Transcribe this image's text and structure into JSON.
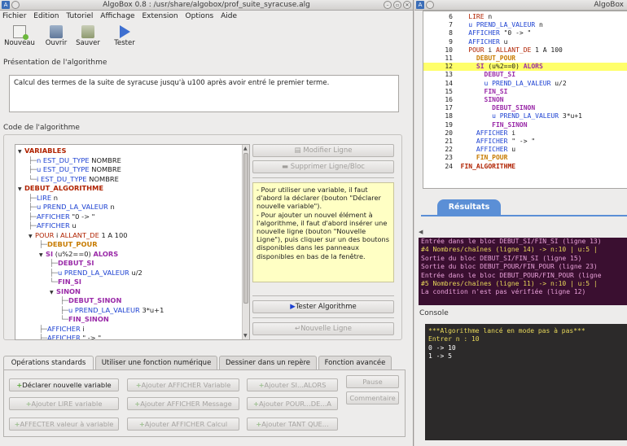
{
  "left_window": {
    "title": "AlgoBox 0.8 : /usr/share/algobox/prof_suite_syracuse.alg",
    "menu": [
      "Fichier",
      "Edition",
      "Tutoriel",
      "Affichage",
      "Extension",
      "Options",
      "Aide"
    ],
    "toolbar": {
      "new_label": "Nouveau",
      "open_label": "Ouvrir",
      "save_label": "Sauver",
      "test_label": "Tester"
    },
    "presentation_label": "Présentation de l'algorithme",
    "presentation_text": "Calcul des termes de la suite de syracuse jusqu'à u100 après avoir entré le premier terme.",
    "code_label": "Code de l'algorithme",
    "tree": [
      {
        "prefix": "▼",
        "parts": [
          [
            "kw",
            "VARIABLES"
          ]
        ]
      },
      {
        "prefix": "├─",
        "parts": [
          [
            "blue",
            "n"
          ],
          [
            "plain",
            " "
          ],
          [
            "blue",
            "EST_DU_TYPE"
          ],
          [
            "plain",
            " NOMBRE"
          ]
        ]
      },
      {
        "prefix": "├─",
        "parts": [
          [
            "blue",
            "u"
          ],
          [
            "plain",
            " "
          ],
          [
            "blue",
            "EST_DU_TYPE"
          ],
          [
            "plain",
            " NOMBRE"
          ]
        ]
      },
      {
        "prefix": "└─",
        "parts": [
          [
            "blue",
            "i"
          ],
          [
            "plain",
            " "
          ],
          [
            "blue",
            "EST_DU_TYPE"
          ],
          [
            "plain",
            " NOMBRE"
          ]
        ]
      },
      {
        "prefix": "▼",
        "parts": [
          [
            "kw",
            "DEBUT_ALGORITHME"
          ]
        ]
      },
      {
        "prefix": "├─",
        "parts": [
          [
            "blue",
            "LIRE"
          ],
          [
            "plain",
            " n"
          ]
        ]
      },
      {
        "prefix": "├─",
        "parts": [
          [
            "blue",
            "u"
          ],
          [
            "plain",
            " "
          ],
          [
            "blue",
            "PREND_LA_VALEUR"
          ],
          [
            "plain",
            " n"
          ]
        ]
      },
      {
        "prefix": "├─",
        "parts": [
          [
            "blue",
            "AFFICHER"
          ],
          [
            "plain",
            " \"0 -> \""
          ]
        ]
      },
      {
        "prefix": "├─",
        "parts": [
          [
            "blue",
            "AFFICHER"
          ],
          [
            "plain",
            " u"
          ]
        ]
      },
      {
        "prefix": "▼",
        "parts": [
          [
            "kw2",
            "POUR"
          ],
          [
            "plain",
            " i "
          ],
          [
            "kw2",
            "ALLANT_DE"
          ],
          [
            "plain",
            " 1 A 100"
          ]
        ]
      },
      {
        "prefix": "├─",
        "parts": [
          [
            "kwy",
            "DEBUT_POUR"
          ]
        ]
      },
      {
        "prefix": "▼",
        "parts": [
          [
            "kwm",
            "SI"
          ],
          [
            "plain",
            " (u%2==0) "
          ],
          [
            "kwm",
            "ALORS"
          ]
        ]
      },
      {
        "prefix": "├─",
        "parts": [
          [
            "kwm",
            "DEBUT_SI"
          ]
        ]
      },
      {
        "prefix": "├─",
        "parts": [
          [
            "blue",
            "u"
          ],
          [
            "plain",
            " "
          ],
          [
            "blue",
            "PREND_LA_VALEUR"
          ],
          [
            "plain",
            " u/2"
          ]
        ]
      },
      {
        "prefix": "└─",
        "parts": [
          [
            "kwm",
            "FIN_SI"
          ]
        ]
      },
      {
        "prefix": "▼",
        "parts": [
          [
            "kwm",
            "SINON"
          ]
        ]
      },
      {
        "prefix": "├─",
        "parts": [
          [
            "kwm",
            "DEBUT_SINON"
          ]
        ]
      },
      {
        "prefix": "├─",
        "parts": [
          [
            "blue",
            "u"
          ],
          [
            "plain",
            " "
          ],
          [
            "blue",
            "PREND_LA_VALEUR"
          ],
          [
            "plain",
            " 3*u+1"
          ]
        ]
      },
      {
        "prefix": "└─",
        "parts": [
          [
            "kwm",
            "FIN_SINON"
          ]
        ]
      },
      {
        "prefix": "├─",
        "parts": [
          [
            "blue",
            "AFFICHER"
          ],
          [
            "plain",
            " i"
          ]
        ]
      },
      {
        "prefix": "├─",
        "parts": [
          [
            "blue",
            "AFFICHER"
          ],
          [
            "plain",
            " \" -> \""
          ]
        ]
      }
    ],
    "buttons": {
      "modify_line": "Modifier Ligne",
      "delete_line": "Supprimer Ligne/Bloc",
      "test_algorithm": "Tester Algorithme",
      "new_line": "Nouvelle Ligne"
    },
    "help_text": "- Pour utiliser une variable, il faut d'abord la déclarer (bouton \"Déclarer nouvelle variable\").\n- Pour ajouter un nouvel élément à l'algorithme, il faut d'abord insérer une nouvelle ligne (bouton \"Nouvelle Ligne\"), puis cliquer sur un des boutons disponibles dans les panneaux disponibles en bas de la fenêtre.",
    "tabs": [
      "Opérations standards",
      "Utiliser une fonction numérique",
      "Dessiner dans un repère",
      "Fonction avancée"
    ],
    "ops": {
      "declare_variable": "Déclarer nouvelle variable",
      "add_read": "Ajouter LIRE variable",
      "assign": "AFFECTER valeur à variable",
      "add_print_var": "Ajouter AFFICHER Variable",
      "add_print_msg": "Ajouter AFFICHER Message",
      "add_print_calc": "Ajouter AFFICHER Calcul",
      "add_if": "Ajouter SI...ALORS",
      "add_for": "Ajouter POUR...DE...A",
      "add_while": "Ajouter TANT QUE...",
      "pause": "Pause",
      "comment": "Commentaire"
    }
  },
  "right_window": {
    "title": "AlgoBox",
    "code_lines": [
      {
        "n": "6",
        "indent": "  ",
        "parts": [
          [
            "kw2",
            "LIRE"
          ],
          [
            "plain",
            " n"
          ]
        ]
      },
      {
        "n": "7",
        "indent": "  ",
        "parts": [
          [
            "blue",
            "u PREND_LA_VALEUR"
          ],
          [
            "plain",
            " n"
          ]
        ]
      },
      {
        "n": "8",
        "indent": "  ",
        "parts": [
          [
            "blue",
            "AFFICHER"
          ],
          [
            "plain",
            " \"0 -> \""
          ]
        ]
      },
      {
        "n": "9",
        "indent": "  ",
        "parts": [
          [
            "blue",
            "AFFICHER"
          ],
          [
            "plain",
            " u"
          ]
        ]
      },
      {
        "n": "10",
        "indent": "  ",
        "parts": [
          [
            "kw2",
            "POUR"
          ],
          [
            "plain",
            " i "
          ],
          [
            "kw2",
            "ALLANT_DE"
          ],
          [
            "plain",
            " 1 A 100"
          ]
        ]
      },
      {
        "n": "11",
        "indent": "    ",
        "parts": [
          [
            "kwy",
            "DEBUT_POUR"
          ]
        ]
      },
      {
        "n": "12",
        "indent": "    ",
        "parts": [
          [
            "kwm",
            "SI"
          ],
          [
            "plain",
            " (u%2==0) "
          ],
          [
            "kwm",
            "ALORS"
          ]
        ],
        "highlight": true
      },
      {
        "n": "13",
        "indent": "      ",
        "parts": [
          [
            "kwm",
            "DEBUT_SI"
          ]
        ]
      },
      {
        "n": "14",
        "indent": "      ",
        "parts": [
          [
            "blue",
            "u PREND_LA_VALEUR"
          ],
          [
            "plain",
            " u/2"
          ]
        ]
      },
      {
        "n": "15",
        "indent": "      ",
        "parts": [
          [
            "kwm",
            "FIN_SI"
          ]
        ]
      },
      {
        "n": "16",
        "indent": "      ",
        "parts": [
          [
            "kwm",
            "SINON"
          ]
        ]
      },
      {
        "n": "17",
        "indent": "        ",
        "parts": [
          [
            "kwm",
            "DEBUT_SINON"
          ]
        ]
      },
      {
        "n": "18",
        "indent": "        ",
        "parts": [
          [
            "blue",
            "u PREND_LA_VALEUR"
          ],
          [
            "plain",
            " 3*u+1"
          ]
        ]
      },
      {
        "n": "19",
        "indent": "        ",
        "parts": [
          [
            "kwm",
            "FIN_SINON"
          ]
        ]
      },
      {
        "n": "20",
        "indent": "    ",
        "parts": [
          [
            "blue",
            "AFFICHER"
          ],
          [
            "plain",
            " i"
          ]
        ]
      },
      {
        "n": "21",
        "indent": "    ",
        "parts": [
          [
            "blue",
            "AFFICHER"
          ],
          [
            "plain",
            " \" -> \""
          ]
        ]
      },
      {
        "n": "22",
        "indent": "    ",
        "parts": [
          [
            "blue",
            "AFFICHER"
          ],
          [
            "plain",
            " u"
          ]
        ]
      },
      {
        "n": "23",
        "indent": "    ",
        "parts": [
          [
            "kwy",
            "FIN_POUR"
          ]
        ]
      },
      {
        "n": "24",
        "indent": "",
        "parts": [
          [
            "kw",
            "FIN_ALGORITHME"
          ]
        ]
      }
    ],
    "results_label": "Résultats",
    "trace_lines": [
      {
        "text": "Entrée dans le bloc DEBUT_SI/FIN_SI (ligne 13)",
        "color": "#e8a0d8"
      },
      {
        "text": "#4 Nombres/chaînes (ligne 14) -> n:10 | u:5 |",
        "color": "#e8d85a"
      },
      {
        "text": "Sortie du bloc DEBUT_SI/FIN_SI (ligne 15)",
        "color": "#e8a0d8"
      },
      {
        "text": "Sortie du bloc DEBUT_POUR/FIN_POUR (ligne 23)",
        "color": "#e8a0d8"
      },
      {
        "text": "Entrée dans le bloc DEBUT_POUR/FIN_POUR (ligne",
        "color": "#e8a0d8"
      },
      {
        "text": "#5 Nombres/chaînes (ligne 11) -> n:10 | u:5 |",
        "color": "#e8d85a"
      },
      {
        "text": "La condition n'est pas vérifiée (ligne 12)",
        "color": "#e8a0d8"
      }
    ],
    "console_label": "Console",
    "console_lines": [
      {
        "text": "***Algorithme lancé en mode pas à pas***",
        "color": "#e8d85a"
      },
      {
        "text": "Entrer n : 10",
        "color": "#e8d85a"
      },
      {
        "text": "0 -> 10",
        "color": "#ffffff"
      },
      {
        "text": "1 -> 5",
        "color": "#ffffff"
      }
    ]
  }
}
